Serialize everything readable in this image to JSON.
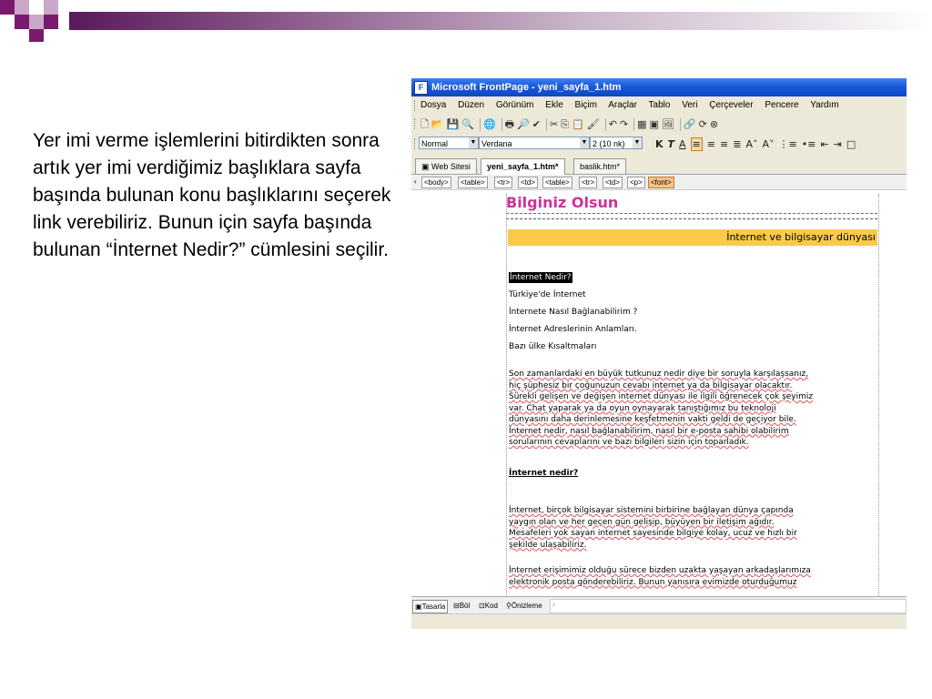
{
  "slide": {
    "paragraph": "Yer imi verme işlemlerini bitirdikten sonra artık yer imi verdiğimiz başlıklara sayfa başında bulunan konu başlıklarını seçerek link verebiliriz. Bunun için sayfa başında bulunan “İnternet Nedir?” cümlesini seçilir.",
    "deco_colors": {
      "dark": "#7a1a6e",
      "light": "#c9a8c9"
    }
  },
  "window": {
    "title": "Microsoft FrontPage - yeni_sayfa_1.htm",
    "menu": [
      "Dosya",
      "Düzen",
      "Görünüm",
      "Ekle",
      "Biçim",
      "Araçlar",
      "Tablo",
      "Veri",
      "Çerçeveler",
      "Pencere",
      "Yardım"
    ],
    "format": {
      "style": "Normal",
      "font": "Verdana",
      "size": "2 (10 nk)"
    },
    "tabs": [
      "Web Sitesi",
      "yeni_sayfa_1.htm*",
      "baslik.htm*"
    ],
    "tags": [
      "<body>",
      "<table>",
      "<tr>",
      "<td>",
      "<table>",
      "<tr>",
      "<td>",
      "<p>",
      "<font>"
    ]
  },
  "document": {
    "heading": "Bilginiz Olsun",
    "banner": "İnternet ve bilgisayar dünyası",
    "links": [
      "İnternet Nedir?",
      "Türkiye'de İnternet",
      "İnternete Nasıl Bağlanabilirim ?",
      "İnternet Adreslerinin Anlamları.",
      "Bazı ülke Kısaltmaları"
    ],
    "para1": [
      "Son zamanlardaki en büyük tutkunuz nedir diye bir soruyla karşılaşsanız,",
      "hiç şüphesiz bir çoğunuzun cevabı internet ya da bilgisayar olacaktır.",
      "Sürekli gelişen ve değişen internet dünyası ile ilgili öğrenecek çok şeyimiz",
      "var. Chat yaparak ya da oyun oynayarak tanıştığımız bu teknoloji",
      "dünyasını daha derinlemesine keşfetmenin vakti geldi de geçiyor bile.",
      "İnternet nedir, nasıl bağlanabilirim, nasıl bir e-posta sahibi olabilirim",
      "sorularının cevaplarını ve bazı bilgileri sizin için toparladık."
    ],
    "subheading": "İnternet nedir?",
    "para2": [
      "İnternet, birçok bilgisayar sistemini birbirine bağlayan dünya çapında",
      "yaygın olan ve her geçen gün gelişip, büyüyen bir iletişim ağıdır.",
      "Mesafeleri yok sayan internet sayesinde bilgiye kolay, ucuz ve hızlı bir",
      "şekilde ulaşabiliriz."
    ],
    "para3": [
      "İnternet erişimimiz olduğu sürece bizden uzakta yaşayan arkadaşlarımıza",
      "elektronik posta gönderebiliriz. Bunun yanısıra evimizde oturduğumuz"
    ]
  },
  "views": [
    "Tasarla",
    "Böl",
    "Kod",
    "Önizleme"
  ]
}
